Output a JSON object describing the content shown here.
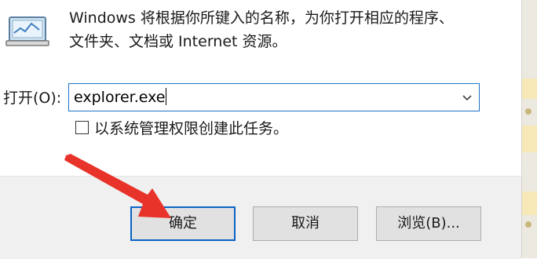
{
  "dialog": {
    "description_line1": "Windows 将根据你所键入的名称，为你打开相应的程序、",
    "description_line2": "文件夹、文档或 Internet 资源。",
    "open_label": "打开(O):",
    "command_value": "explorer.exe",
    "admin_checkbox_label": "以系统管理权限创建此任务。",
    "admin_checkbox_checked": false
  },
  "buttons": {
    "ok": "确定",
    "cancel": "取消",
    "browse": "浏览(B)..."
  },
  "icons": {
    "run": "run-program-icon",
    "dropdown": "chevron-down-icon",
    "annotation": "red-arrow-annotation"
  },
  "colors": {
    "focus_border": "#1e74c8",
    "default_button_border": "#0a63c4",
    "annotation_arrow": "#e8332a",
    "button_bar": "#f0f0f0"
  }
}
